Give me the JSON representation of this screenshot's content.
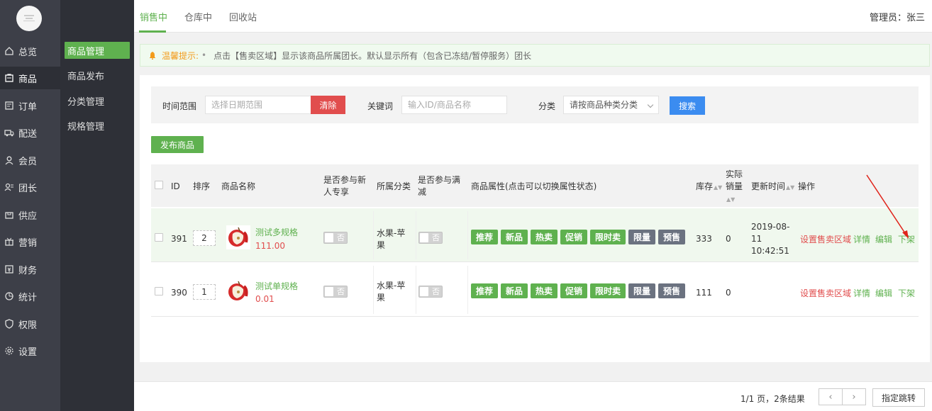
{
  "nav": {
    "items": [
      {
        "label": "总览",
        "icon": "home-icon"
      },
      {
        "label": "商品",
        "icon": "goods-icon"
      },
      {
        "label": "订单",
        "icon": "order-icon"
      },
      {
        "label": "配送",
        "icon": "delivery-icon"
      },
      {
        "label": "会员",
        "icon": "member-icon"
      },
      {
        "label": "团长",
        "icon": "leader-icon"
      },
      {
        "label": "供应",
        "icon": "supply-icon"
      },
      {
        "label": "营销",
        "icon": "gift-icon"
      },
      {
        "label": "财务",
        "icon": "finance-icon"
      },
      {
        "label": "统计",
        "icon": "stats-icon"
      },
      {
        "label": "权限",
        "icon": "permission-icon"
      },
      {
        "label": "设置",
        "icon": "settings-icon"
      }
    ]
  },
  "subnav": {
    "items": [
      {
        "label": "商品管理"
      },
      {
        "label": "商品发布"
      },
      {
        "label": "分类管理"
      },
      {
        "label": "规格管理"
      }
    ]
  },
  "header": {
    "tabs": [
      {
        "label": "销售中"
      },
      {
        "label": "仓库中"
      },
      {
        "label": "回收站"
      }
    ],
    "admin": "管理员：张三"
  },
  "notice": {
    "tip": "温馨提示:",
    "dot": "•",
    "text": "点击【售卖区域】显示该商品所属团长。默认显示所有（包含已冻结/暂停服务）团长"
  },
  "filter": {
    "time_label": "时间范围",
    "time_placeholder": "选择日期范围",
    "clear": "清除",
    "keyword_label": "关键词",
    "keyword_placeholder": "输入ID/商品名称",
    "category_label": "分类",
    "category_value": "请按商品种类分类",
    "search": "搜索"
  },
  "publish_button": "发布商品",
  "table": {
    "headers": {
      "id": "ID",
      "sort": "排序",
      "name": "商品名称",
      "newuser": "是否参与新人专享",
      "category": "所属分类",
      "fullcut": "是否参与满减",
      "attrs": "商品属性(点击可以切换属性状态)",
      "stock": "库存",
      "sales": "实际销量",
      "updated": "更新时间",
      "ops": "操作"
    },
    "rows": [
      {
        "id": "391",
        "sort": "2",
        "name": "测试多规格",
        "price": "111.00",
        "newuser": "否",
        "category": "水果-苹果",
        "fullcut": "否",
        "stock": "333",
        "sales": "0",
        "updated": "2019-08-11 10:42:51"
      },
      {
        "id": "390",
        "sort": "1",
        "name": "测试单规格",
        "price": "0.01",
        "newuser": "否",
        "category": "水果-苹果",
        "fullcut": "否",
        "stock": "111",
        "sales": "0",
        "updated": ""
      }
    ],
    "attrs": [
      "推荐",
      "新品",
      "热卖",
      "促销",
      "限时卖",
      "限量",
      "预售"
    ],
    "ops": {
      "area": "设置售卖区域",
      "detail": "详情",
      "edit": "编辑",
      "offshelf": "下架"
    }
  },
  "pagination": {
    "info": "1/1 页，2条结果",
    "prev": "‹",
    "next": "›",
    "jump": "指定跳转"
  },
  "colors": {
    "accent": "#5fb14f",
    "danger": "#e14d4d",
    "primary": "#3b8cf0",
    "nav_bg": "#3d3f48"
  }
}
